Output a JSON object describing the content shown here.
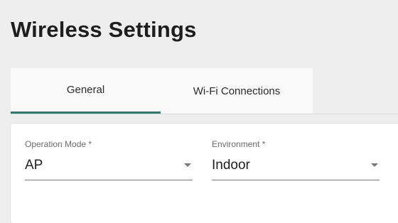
{
  "page": {
    "title": "Wireless Settings"
  },
  "tabs": [
    {
      "label": "General",
      "active": true
    },
    {
      "label": "Wi-Fi Connections",
      "active": false
    }
  ],
  "form": {
    "operation_mode": {
      "label": "Operation Mode *",
      "value": "AP"
    },
    "environment": {
      "label": "Environment *",
      "value": "Indoor"
    }
  },
  "colors": {
    "accent": "#0c8a76",
    "background": "#eeeeee",
    "card": "#ffffff"
  }
}
